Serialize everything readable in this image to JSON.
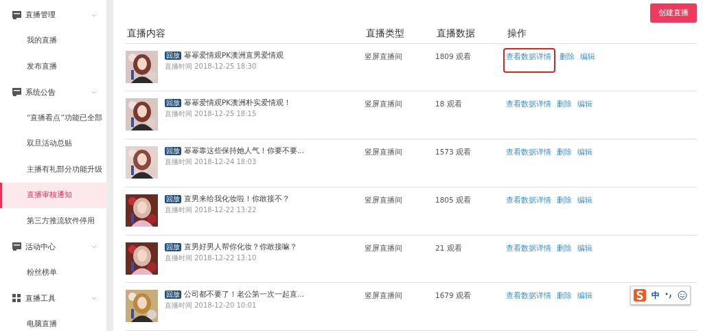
{
  "sidebar": {
    "groups": [
      {
        "label": "直播管理",
        "kind": "monitor",
        "expanded": true,
        "items": [
          {
            "label": "我的直播",
            "selected": false
          },
          {
            "label": "发布直播",
            "selected": false
          }
        ]
      },
      {
        "label": "系统公告",
        "kind": "monitor",
        "expanded": true,
        "items": [
          {
            "label": "“直播看点”功能已全部",
            "selected": false
          },
          {
            "label": "双旦活动总贴",
            "selected": false
          },
          {
            "label": "主播有礼部分功能升级",
            "selected": false
          },
          {
            "label": "直播审核通知",
            "selected": true
          },
          {
            "label": "第三方推流软件停用",
            "selected": false
          }
        ]
      },
      {
        "label": "活动中心",
        "kind": "monitor",
        "expanded": true,
        "items": [
          {
            "label": "粉丝榜单",
            "selected": false
          }
        ]
      },
      {
        "label": "直播工具",
        "kind": "grid",
        "expanded": true,
        "items": [
          {
            "label": "电脑直播",
            "selected": false
          }
        ]
      }
    ]
  },
  "create_button": "创建直播",
  "table": {
    "columns": [
      "直播内容",
      "直播类型",
      "直播数据",
      "操作"
    ],
    "rows": [
      {
        "badge": "回放",
        "title": "幂幂爱情观PK澳洲直男爱情观",
        "time": "直播时间 2018-12-25 18:30",
        "type": "竖屏直播间",
        "data": "1809 观看",
        "actions": [
          "查看数据详情",
          "删除",
          "编辑"
        ],
        "highlighted": true
      },
      {
        "badge": "回放",
        "title": "幂幂爱情观PK澳洲朴实爱情观！",
        "time": "直播时间 2018-12-25 18:15",
        "type": "竖屏直播间",
        "data": "18 观看",
        "actions": [
          "查看数据详情",
          "删除",
          "编辑"
        ],
        "highlighted": false
      },
      {
        "badge": "回放",
        "title": "幂幂靠这些保持她人气！你要不要...",
        "time": "直播时间 2018-12-24 18:03",
        "type": "竖屏直播间",
        "data": "1573 观看",
        "actions": [
          "查看数据详情",
          "删除",
          "编辑"
        ],
        "highlighted": false
      },
      {
        "badge": "回放",
        "title": "直男来给我化妆啦！你敢接不？",
        "time": "直播时间 2018-12-22 13:22",
        "type": "竖屏直播间",
        "data": "1805 观看",
        "actions": [
          "查看数据详情",
          "删除",
          "编辑"
        ],
        "highlighted": false
      },
      {
        "badge": "回放",
        "title": "直男好男人帮你化妆？你敢接嘛？",
        "time": "直播时间 2018-12-22 13:10",
        "type": "竖屏直播间",
        "data": "21 观看",
        "actions": [
          "查看数据详情",
          "删除",
          "编辑"
        ],
        "highlighted": false
      },
      {
        "badge": "回放",
        "title": "公司都不要了！老公第一次一起直...",
        "time": "直播时间 2018-12-20 10:01",
        "type": "竖屏直播间",
        "data": "1679 观看",
        "actions": [
          "查看数据详情",
          "删除",
          "编辑"
        ],
        "highlighted": false
      }
    ]
  },
  "ime_toolbar": {
    "mode": "中"
  }
}
